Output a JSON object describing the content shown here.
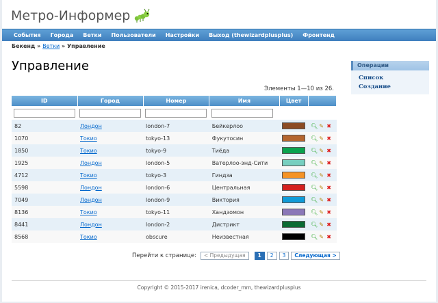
{
  "header": {
    "app_title": "Метро-Информер"
  },
  "mainmenu": [
    "События",
    "Города",
    "Ветки",
    "Пользователи",
    "Настройки",
    "Выход (thewizardplusplus)",
    "Фронтенд"
  ],
  "breadcrumbs": {
    "home": "Бекенд",
    "sep1": "»",
    "link": "Ветки",
    "sep2": "»",
    "current": "Управление"
  },
  "page_title": "Управление",
  "summary": "Элементы 1—10 из 26.",
  "table": {
    "headers": [
      "ID",
      "Город",
      "Номер",
      "Имя",
      "Цвет"
    ],
    "rows": [
      {
        "id": "82",
        "city": "Лондон",
        "number": "london-7",
        "name": "Бейкерлоо",
        "color": "#8b4b24"
      },
      {
        "id": "1070",
        "city": "Токио",
        "number": "tokyo-13",
        "name": "Фукутосин",
        "color": "#b5652e"
      },
      {
        "id": "1850",
        "city": "Токио",
        "number": "tokyo-9",
        "name": "Тиёда",
        "color": "#0aa24e"
      },
      {
        "id": "1925",
        "city": "Лондон",
        "number": "london-5",
        "name": "Ватерлоо-энд-Сити",
        "color": "#77cfc0"
      },
      {
        "id": "4712",
        "city": "Токио",
        "number": "tokyo-3",
        "name": "Гиндза",
        "color": "#f59325"
      },
      {
        "id": "5598",
        "city": "Лондон",
        "number": "london-6",
        "name": "Центральная",
        "color": "#d4211f"
      },
      {
        "id": "7049",
        "city": "Лондон",
        "number": "london-9",
        "name": "Виктория",
        "color": "#0f9bd8"
      },
      {
        "id": "8136",
        "city": "Токио",
        "number": "tokyo-11",
        "name": "Хандзомон",
        "color": "#8b78b8"
      },
      {
        "id": "8441",
        "city": "Лондон",
        "number": "london-2",
        "name": "Дистрикт",
        "color": "#0a6b34"
      },
      {
        "id": "8568",
        "city": "Токио",
        "number": "obscure",
        "name": "Неизвестная",
        "color": "#000000"
      }
    ]
  },
  "pager": {
    "label": "Перейти к странице:",
    "prev": "< Предыдущая",
    "pages": [
      "1",
      "2",
      "3"
    ],
    "current_page": "1",
    "next": "Следующая >"
  },
  "footer": "Copyright © 2015-2017 irenica, dcoder_mm, thewizardplusplus",
  "sidebar": {
    "title": "Операции",
    "items": [
      "Список",
      "Создание"
    ]
  },
  "icons": {
    "logo": "caterpillar-icon",
    "view": "magnifier-icon",
    "edit": "pencil-icon",
    "delete": "delete-x-icon"
  }
}
